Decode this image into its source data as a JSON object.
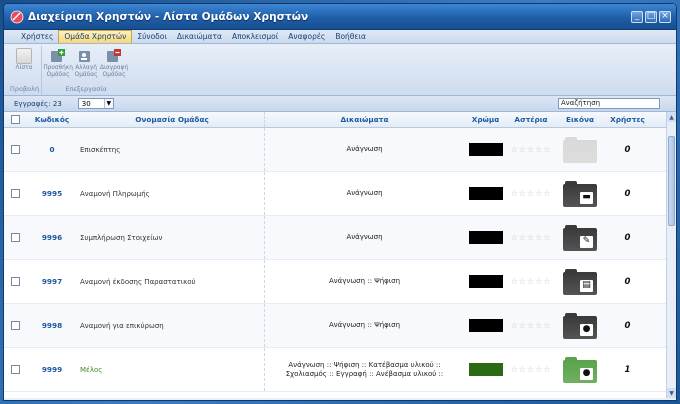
{
  "window": {
    "title": "Διαχείριση Χρηστών - Λίστα Ομάδων Χρηστών",
    "controls": [
      "_",
      "□",
      "×"
    ]
  },
  "menu": {
    "items": [
      "Χρήστες",
      "Ομάδα Χρηστών",
      "Σύνοδοι",
      "Δικαιώματα",
      "Αποκλεισμοί",
      "Αναφορές",
      "Βοήθεια"
    ],
    "active": "Ομάδα Χρηστών"
  },
  "ribbon": {
    "groups": [
      {
        "label": "Προβολή",
        "buttons": [
          {
            "label": "Λίστα",
            "icon": "list-icon"
          }
        ]
      },
      {
        "label": "Επεξεργασία",
        "buttons": [
          {
            "label": "Προσθήκη Ομάδας",
            "icon": "add-group-icon"
          },
          {
            "label": "Αλλαγή Ομάδας",
            "icon": "edit-group-icon"
          },
          {
            "label": "Διαγραφή Ομάδας",
            "icon": "delete-group-icon"
          }
        ]
      }
    ]
  },
  "toolbar": {
    "records_label": "Εγγραφές: 23",
    "page_size": "30",
    "search_placeholder": "Αναζήτηση"
  },
  "table": {
    "headers": {
      "code": "Κωδικός",
      "name": "Ονομασία Ομάδας",
      "permissions": "Δικαιώματα",
      "color": "Χρώμα",
      "rating": "Αστέρια",
      "image": "Εικόνα",
      "users": "Χρήστες"
    },
    "rows": [
      {
        "code": "0",
        "name": "Επισκέπτης",
        "permissions": "Ανάγνωση",
        "color": "#000000",
        "stars": "☆☆☆☆☆",
        "image": "folder-empty",
        "image_color": "#d9d9d9",
        "badge": "",
        "users": "0"
      },
      {
        "code": "9995",
        "name": "Αναμονή Πληρωμής",
        "permissions": "Ανάγνωση",
        "color": "#000000",
        "stars": "☆☆☆☆☆",
        "image": "folder-card",
        "image_color": "#3a3a3a",
        "badge": "▬",
        "users": "0"
      },
      {
        "code": "9996",
        "name": "Συμπλήρωση Στοιχείων",
        "permissions": "Ανάγνωση",
        "color": "#000000",
        "stars": "☆☆☆☆☆",
        "image": "folder-edit",
        "image_color": "#3a3a3a",
        "badge": "✎",
        "users": "0"
      },
      {
        "code": "9997",
        "name": "Αναμονή έκδοσης Παραστατικού",
        "permissions": "Ανάγνωση :: Ψήφιση",
        "color": "#000000",
        "stars": "☆☆☆☆☆",
        "image": "folder-print",
        "image_color": "#3a3a3a",
        "badge": "▤",
        "users": "0"
      },
      {
        "code": "9998",
        "name": "Αναμονή για επικύρωση",
        "permissions": "Ανάγνωση :: Ψήφιση",
        "color": "#000000",
        "stars": "☆☆☆☆☆",
        "image": "folder-user-search",
        "image_color": "#3a3a3a",
        "badge": "●",
        "users": "0"
      },
      {
        "code": "9999",
        "name": "Μέλος",
        "permissions": "Ανάγνωση :: Ψήφιση :: Κατέβασμα υλικού :: Σχολιασμός :: Εγγραφή :: Ανέβασμα υλικού ::",
        "color": "#2a6a12",
        "stars": "☆☆☆☆☆",
        "image": "folder-user",
        "image_color": "#5aa34a",
        "badge": "●",
        "users": "1"
      }
    ]
  },
  "colors": {
    "title_bar": "#1f5ea8",
    "header_text": "#1e5aa0",
    "member_name": "#3d8a2a"
  }
}
